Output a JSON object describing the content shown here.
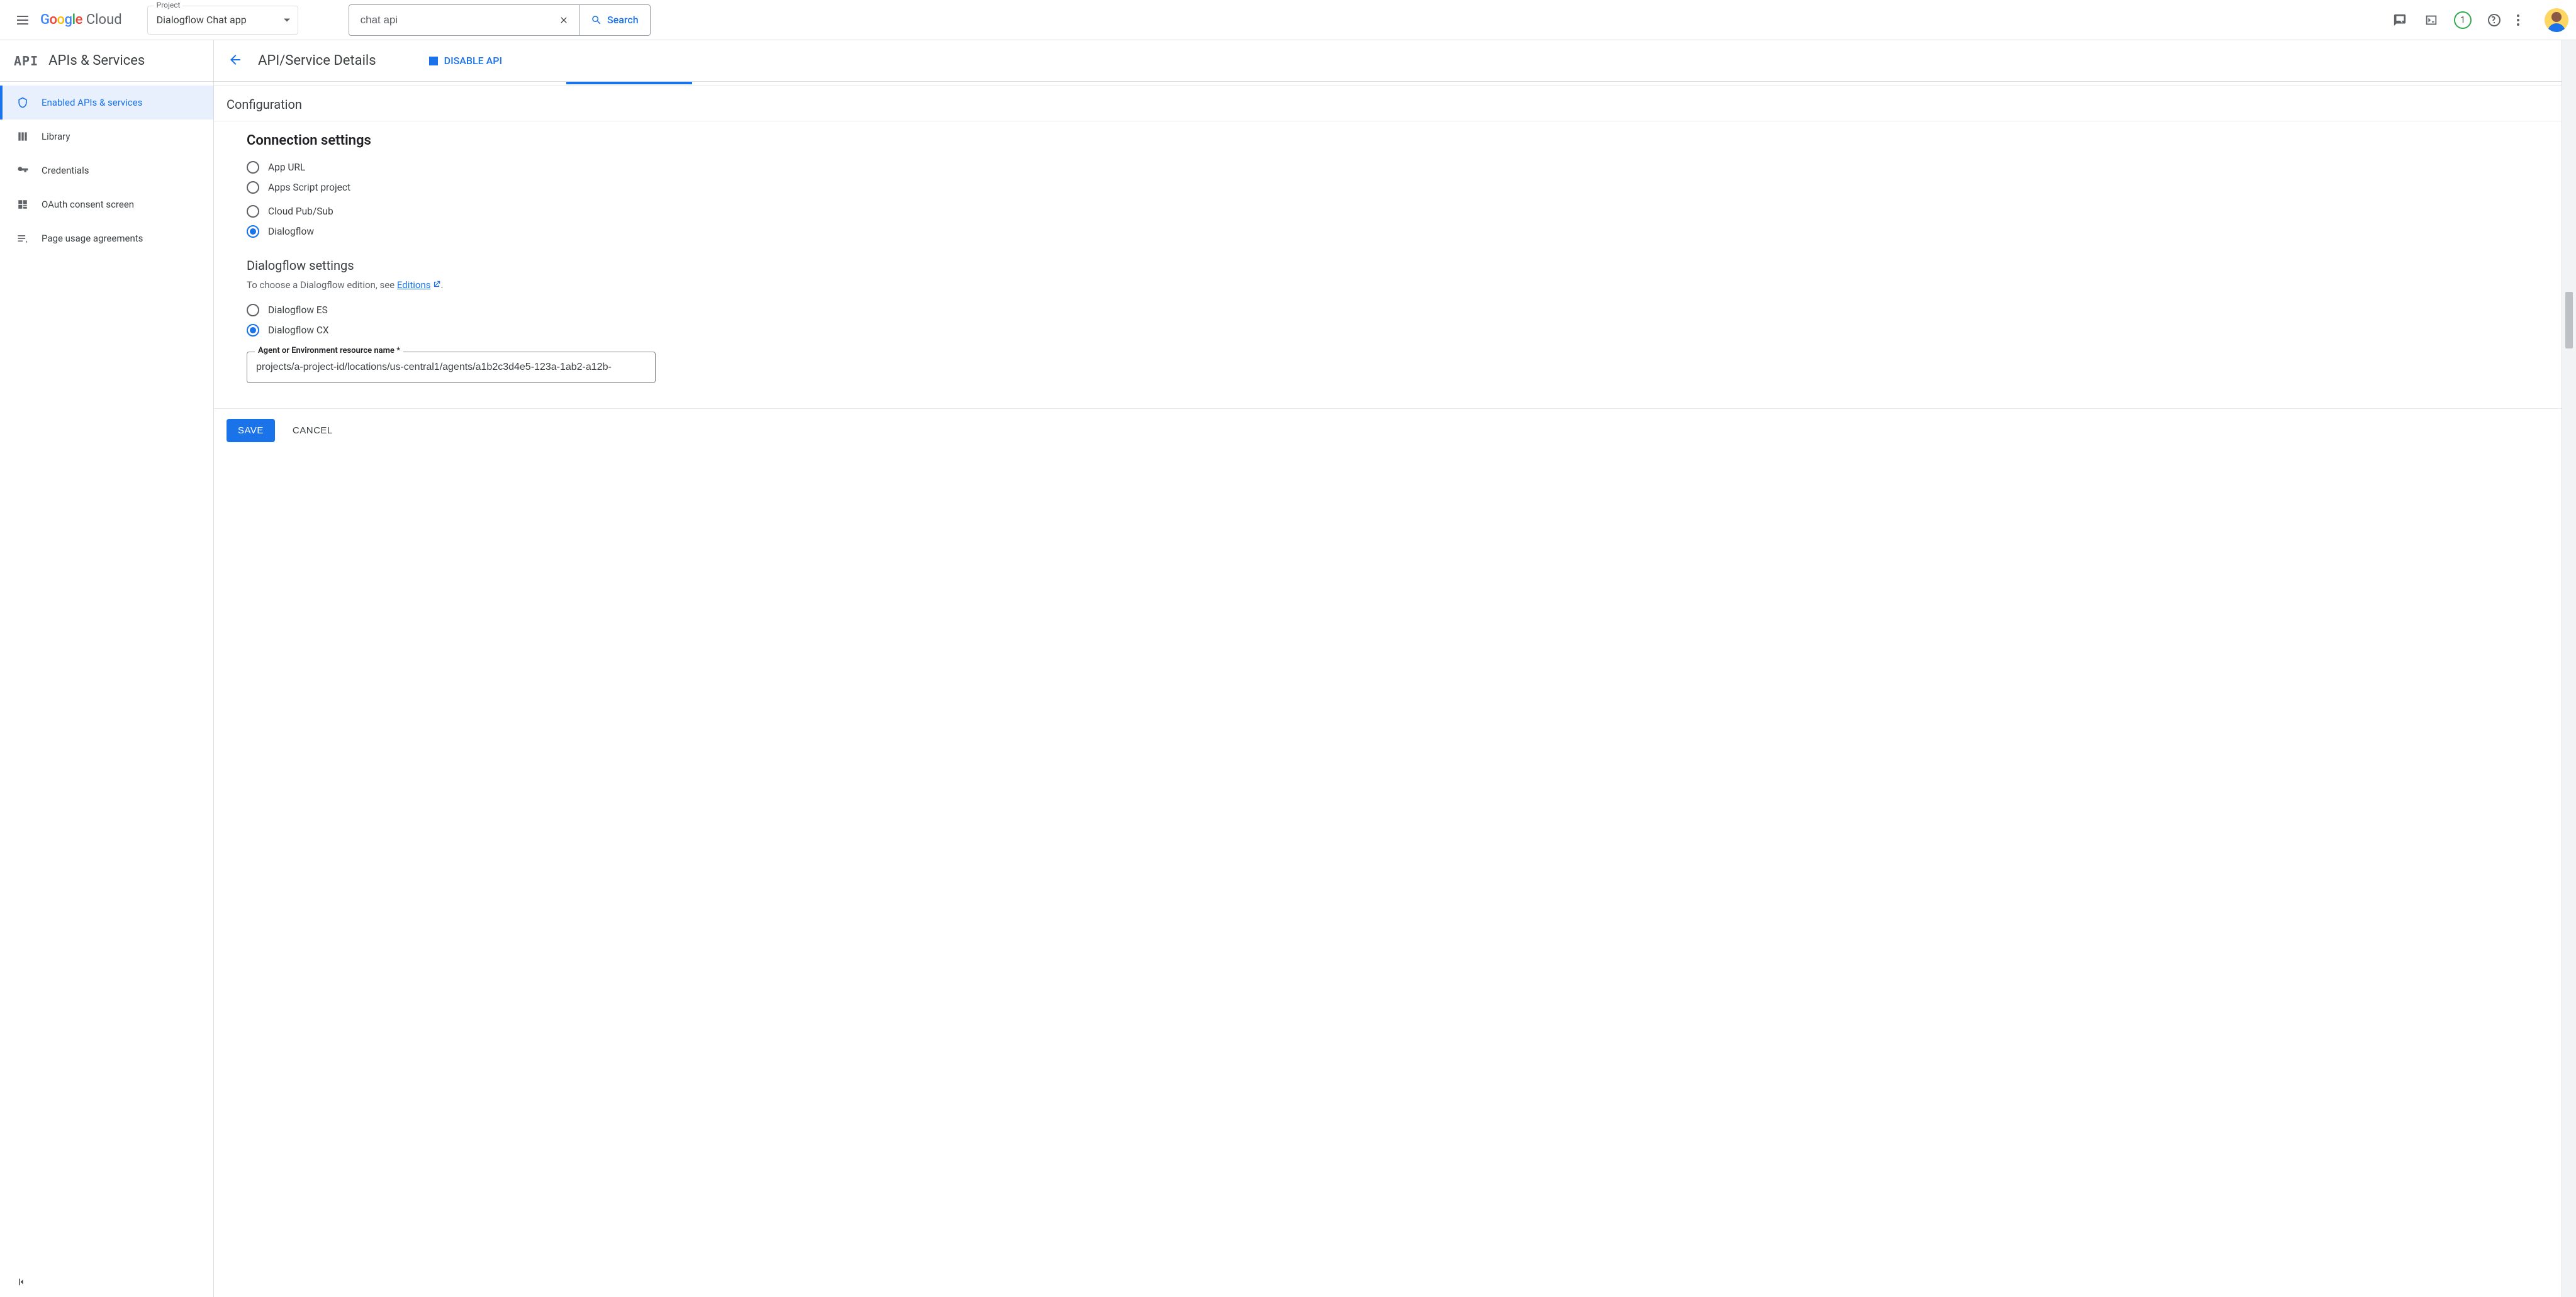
{
  "header": {
    "logo_cloud": "Cloud",
    "project_label": "Project",
    "project_name": "Dialogflow Chat app",
    "search_value": "chat api",
    "search_button": "Search",
    "notification_count": "1"
  },
  "sidebar": {
    "product_code": "API",
    "product_title": "APIs & Services",
    "items": [
      {
        "label": "Enabled APIs & services",
        "active": true
      },
      {
        "label": "Library",
        "active": false
      },
      {
        "label": "Credentials",
        "active": false
      },
      {
        "label": "OAuth consent screen",
        "active": false
      },
      {
        "label": "Page usage agreements",
        "active": false
      }
    ]
  },
  "page": {
    "title": "API/Service Details",
    "disable_label": "DISABLE API",
    "config_heading": "Configuration",
    "connection": {
      "heading": "Connection settings",
      "options": [
        {
          "label": "App URL",
          "checked": false
        },
        {
          "label": "Apps Script project",
          "checked": false
        },
        {
          "label": "Cloud Pub/Sub",
          "checked": false
        },
        {
          "label": "Dialogflow",
          "checked": true
        }
      ]
    },
    "dialogflow": {
      "heading": "Dialogflow settings",
      "helper_prefix": "To choose a Dialogflow edition, see ",
      "helper_link": "Editions",
      "helper_suffix": ".",
      "options": [
        {
          "label": "Dialogflow ES",
          "checked": false
        },
        {
          "label": "Dialogflow CX",
          "checked": true
        }
      ],
      "field_label": "Agent or Environment resource name *",
      "field_value": "projects/a-project-id/locations/us-central1/agents/a1b2c3d4e5-123a-1ab2-a12b-"
    },
    "actions": {
      "save": "SAVE",
      "cancel": "CANCEL"
    }
  }
}
